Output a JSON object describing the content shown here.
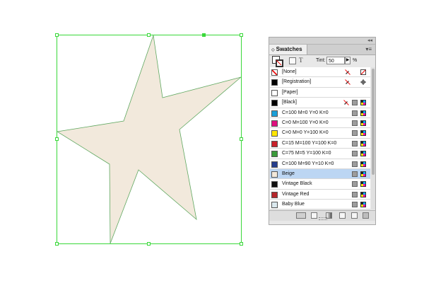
{
  "panel": {
    "tab_label": "Swatches",
    "collapse_glyph": "◂◂",
    "menu_glyph": "▾≡",
    "tint_label": "Tint:",
    "tint_value": "50",
    "tint_unit": "%",
    "text_tool_glyph": "T"
  },
  "swatches": [
    {
      "name": "[None]",
      "color": "none",
      "icons": [
        "no-edit-icon",
        "none-mark-icon"
      ]
    },
    {
      "name": "[Registration]",
      "color": "#000000",
      "icons": [
        "no-edit-icon",
        "registration-icon"
      ]
    },
    {
      "name": "[Paper]",
      "color": "#ffffff",
      "icons": []
    },
    {
      "name": "[Black]",
      "color": "#000000",
      "icons": [
        "no-edit-icon",
        "process-icon",
        "cmyk-icon"
      ]
    },
    {
      "name": "C=100 M=0 Y=0 K=0",
      "color": "#1a9fd8",
      "icons": [
        "process-icon",
        "cmyk-icon"
      ]
    },
    {
      "name": "C=0 M=100 Y=0 K=0",
      "color": "#e0107f",
      "icons": [
        "process-icon",
        "cmyk-icon"
      ]
    },
    {
      "name": "C=0 M=0 Y=100 K=0",
      "color": "#ffe600",
      "icons": [
        "process-icon",
        "cmyk-icon"
      ]
    },
    {
      "name": "C=15 M=100 Y=100 K=0",
      "color": "#c8202a",
      "icons": [
        "process-icon",
        "cmyk-icon"
      ]
    },
    {
      "name": "C=75 M=5 Y=100 K=0",
      "color": "#3a9a3a",
      "icons": [
        "process-icon",
        "cmyk-icon"
      ]
    },
    {
      "name": "C=100 M=90 Y=10 K=0",
      "color": "#253d8d",
      "icons": [
        "process-icon",
        "cmyk-icon"
      ]
    },
    {
      "name": "Beige",
      "color": "#f2e8da",
      "selected": true,
      "icons": [
        "process-icon",
        "cmyk-icon"
      ]
    },
    {
      "name": "Vintage Black",
      "color": "#111111",
      "icons": [
        "process-icon",
        "cmyk-icon"
      ]
    },
    {
      "name": "Vintage Red",
      "color": "#b5262b",
      "icons": [
        "process-icon",
        "cmyk-icon"
      ]
    },
    {
      "name": "Baby Blue",
      "color": "#dbe9ef",
      "icons": [
        "process-icon",
        "cmyk-icon"
      ]
    }
  ],
  "colors": {
    "star_fill": "#f2e9dc",
    "selection": "#39d839",
    "panel_bg": "#e8e8e8",
    "selected_row": "#bcd6f3"
  },
  "bottom_bar_icons": [
    "show-all-swatches-icon",
    "show-color-swatches-icon",
    "show-gradient-swatches-icon",
    "new-color-group-icon",
    "new-swatch-icon",
    "delete-swatch-icon"
  ]
}
